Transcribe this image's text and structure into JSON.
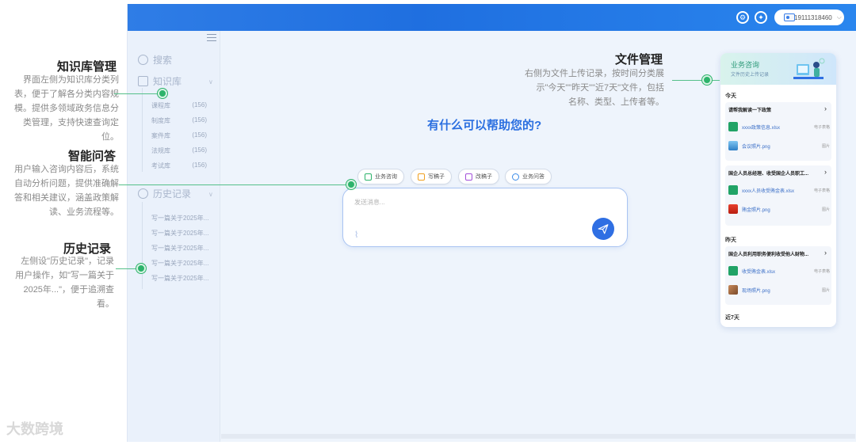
{
  "annotations": {
    "kb": {
      "title": "知识库管理",
      "lines": [
        "界面左侧为知识库分类列",
        "表，便于了解各分类内容规",
        "模。提供多领域政务信息分",
        "类管理，支持快速查询定",
        "位。"
      ]
    },
    "qa": {
      "title": "智能问答",
      "lines": [
        "用户输入咨询内容后，系统",
        "自动分析问题，提供准确解",
        "答和相关建议，涵盖政策解",
        "读、业务流程等。"
      ]
    },
    "history": {
      "title": "历史记录",
      "lines": [
        "左侧设\"历史记录\"，记录",
        "用户操作，如\"写一篇关于",
        "2025年...\"，便于追溯查",
        "看。"
      ]
    },
    "files": {
      "title": "文件管理",
      "lines": [
        "右侧为文件上传记录，按时间分类展",
        "示\"今天\"\"昨天\"\"近7天\"文件，包括",
        "名称、类型、上传者等。"
      ]
    }
  },
  "watermark": "大数跨境",
  "topbar": {
    "user_id": "19111318460"
  },
  "sidebar": {
    "search_label": "搜索",
    "kb_label": "知识库",
    "kb_items": [
      {
        "name": "课程库",
        "count": "(156)"
      },
      {
        "name": "制度库",
        "count": "(156)"
      },
      {
        "name": "案件库",
        "count": "(156)"
      },
      {
        "name": "法规库",
        "count": "(156)"
      },
      {
        "name": "考试库",
        "count": "(156)"
      }
    ],
    "history_label": "历史记录",
    "history_items": [
      "写一篇关于2025年...",
      "写一篇关于2025年...",
      "写一篇关于2025年...",
      "写一篇关于2025年...",
      "写一篇关于2025年..."
    ]
  },
  "main": {
    "headline": "有什么可以帮助您的?",
    "chips": [
      "业务咨询",
      "写稿子",
      "改稿子",
      "业务问答"
    ],
    "input_placeholder": "发送消息..."
  },
  "file_panel": {
    "title": "业务咨询",
    "subtitle": "文件历史上传记录",
    "groups": [
      {
        "label": "今天",
        "cards": [
          {
            "title": "请帮我解读一下政策",
            "files": [
              {
                "name": "xxxx政策信息.xlsx",
                "type": "电子表格",
                "kind": "excel"
              },
              {
                "name": "会议照片.png",
                "type": "图片",
                "kind": "image"
              }
            ]
          },
          {
            "title": "国企人员总经理、收受国企人员职工...",
            "files": [
              {
                "name": "xxxx人员收受贿金表.xlsx",
                "type": "电子表格",
                "kind": "excel"
              },
              {
                "name": "贿金照片.png",
                "type": "图片",
                "kind": "image-red"
              }
            ]
          }
        ]
      },
      {
        "label": "昨天",
        "cards": [
          {
            "title": "国企人员利用职务便利收受他人财物...",
            "files": [
              {
                "name": "收受贿金表.xlsx",
                "type": "电子表格",
                "kind": "excel"
              },
              {
                "name": "现场照片.png",
                "type": "图片",
                "kind": "image-photo"
              }
            ]
          }
        ]
      },
      {
        "label": "近7天",
        "cards": []
      }
    ]
  },
  "colors": {
    "accent": "#2f6fe3",
    "topbar": "#1f6fe0",
    "marker": "#2db36b",
    "excel": "#21a366"
  }
}
